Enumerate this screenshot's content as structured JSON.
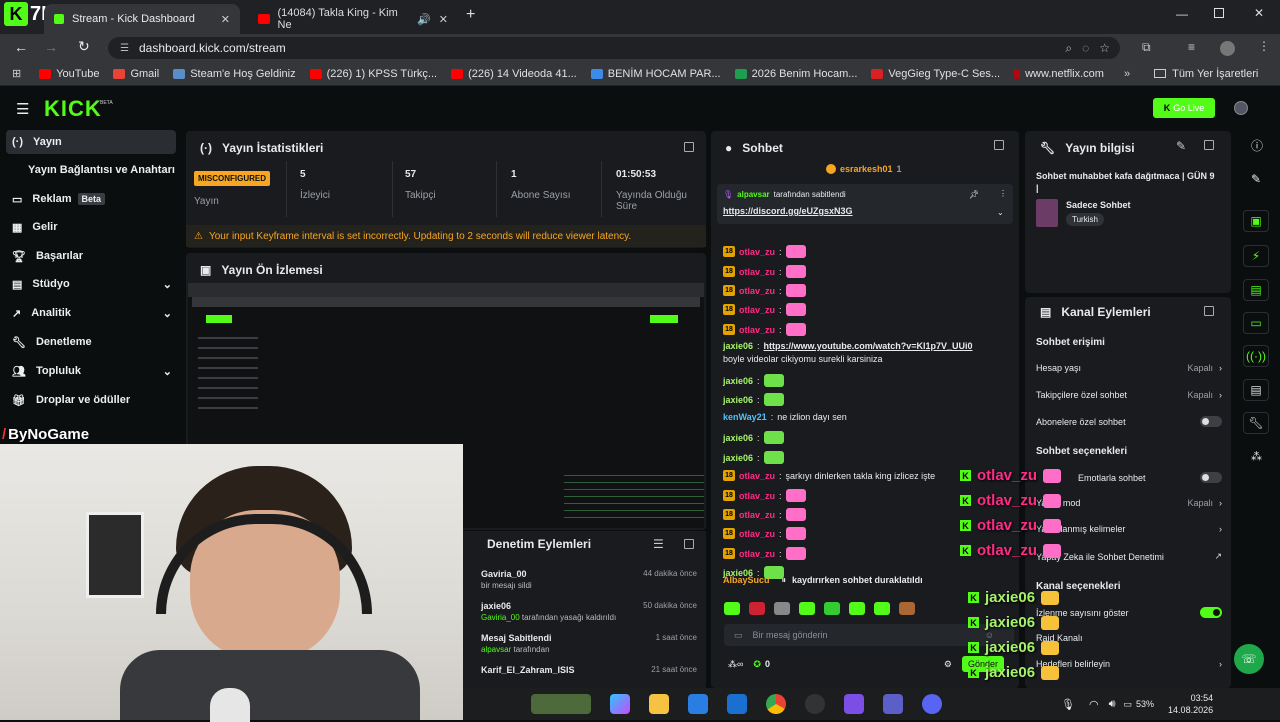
{
  "browser": {
    "tabs": [
      {
        "title": "Stream - Kick Dashboard",
        "active": true
      },
      {
        "title": "(14084) Takla King - Kim Ne",
        "active": false
      }
    ],
    "url": "dashboard.kick.com/stream",
    "bookmarks": [
      "YouTube",
      "Gmail",
      "Steam'e Hoş Geldiniz",
      "(226) 1) KPSS Türkç...",
      "(226) 14 Videoda 41...",
      "BENİM HOCAM PAR...",
      "2026 Benim Hocam...",
      "VegGieg Type-C Ses...",
      "www.netflix.com"
    ],
    "all_bookmarks": "Tüm Yer İşaretleri",
    "stream_overlay_tag": "7K"
  },
  "app": {
    "logo": "KICK",
    "logo_badge": "BETA",
    "go_live": "Go Live"
  },
  "sidebar": {
    "items": [
      {
        "label": "Yayın"
      },
      {
        "label": "Yayın Bağlantısı ve Anahtarı"
      },
      {
        "label": "Reklam",
        "badge": "Beta"
      },
      {
        "label": "Gelir"
      },
      {
        "label": "Başarılar"
      },
      {
        "label": "Stüdyo"
      },
      {
        "label": "Analitik"
      },
      {
        "label": "Denetleme"
      },
      {
        "label": "Topluluk"
      },
      {
        "label": "Droplar ve ödüller"
      }
    ],
    "channel_watermark": "ByNoGame"
  },
  "stats": {
    "title": "Yayın İstatistikleri",
    "status_badge": "MISCONFIGURED",
    "status_label": "Yayın",
    "items": [
      {
        "value": "5",
        "label": "İzleyici"
      },
      {
        "value": "57",
        "label": "Takipçi"
      },
      {
        "value": "1",
        "label": "Abone Sayısı"
      },
      {
        "value": "01:50:53",
        "label": "Yayında Olduğu Süre"
      }
    ],
    "warning": "Your input Keyframe interval is set incorrectly. Updating to 2 seconds will reduce viewer latency."
  },
  "preview": {
    "title": "Yayın Ön İzlemesi"
  },
  "moderation": {
    "title": "Denetim Eylemleri",
    "items": [
      {
        "user": "Gaviria_00",
        "detail": "bir mesajı sildi",
        "time": "44 dakika önce"
      },
      {
        "user": "jaxie06",
        "actor": "Gaviria_00",
        "detail": "tarafından yasağı kaldırıldı",
        "time": "50 dakika önce"
      },
      {
        "user": "Mesaj Sabitlendi",
        "actor": "alpavsar",
        "detail": "tarafından",
        "time": "1 saat önce"
      },
      {
        "user": "Karif_El_Zahram_ISIS",
        "time": "21 saat önce"
      }
    ]
  },
  "chat": {
    "title": "Sohbet",
    "top_user": "esrarkesh01",
    "top_count": "1",
    "pinned": {
      "by": "alpavsar",
      "text": "tarafından sabitlendi",
      "link": "https://discord.gg/eUZgsxN3G"
    },
    "messages": [
      {
        "badge": "18",
        "user": "otlav_zu",
        "text": "",
        "emote": true
      },
      {
        "badge": "18",
        "user": "otlav_zu",
        "text": "",
        "emote": true
      },
      {
        "badge": "18",
        "user": "otlav_zu",
        "text": "",
        "emote": true
      },
      {
        "badge": "18",
        "user": "otlav_zu",
        "text": "",
        "emote": true
      },
      {
        "badge": "18",
        "user": "otlav_zu",
        "text": "",
        "emote": true
      },
      {
        "badge": "",
        "user": "jaxie06",
        "text": "https://www.youtube.com/watch?v=Kl1p7V_UUi0"
      },
      {
        "badge": "",
        "user": "",
        "text": "boyle videolar cikiyomu surekli karsiniza"
      },
      {
        "badge": "",
        "user": "jaxie06",
        "text": "",
        "emote": true
      },
      {
        "badge": "",
        "user": "jaxie06",
        "text": "",
        "emote": true
      },
      {
        "badge": "",
        "user": "kenWay21",
        "text": "ne izlion dayı sen"
      },
      {
        "badge": "",
        "user": "jaxie06",
        "text": "",
        "emote": true
      },
      {
        "badge": "",
        "user": "jaxie06",
        "text": "",
        "emote": true
      },
      {
        "badge": "18",
        "user": "otlav_zu",
        "text": "şarkıyı dinlerken takla king izlicez işte"
      },
      {
        "badge": "18",
        "user": "otlav_zu",
        "text": "",
        "emote": true
      },
      {
        "badge": "18",
        "user": "otlav_zu",
        "text": "",
        "emote": true
      },
      {
        "badge": "18",
        "user": "otlav_zu",
        "text": "",
        "emote": true
      },
      {
        "badge": "18",
        "user": "otlav_zu",
        "text": "",
        "emote": true
      },
      {
        "badge": "",
        "user": "jaxie06",
        "text": "",
        "emote": true
      }
    ],
    "paused_user": "AlbaySucu",
    "paused": "kaydırırken sohbet duraklatıldı",
    "input_placeholder": "Bir mesaj gönderin",
    "points": "0",
    "send": "Gönder"
  },
  "info": {
    "title": "Yayın bilgisi",
    "stream_title": "Sohbet muhabbet kafa dağıtmaca | GÜN 9 |",
    "category": "Sadece Sohbet",
    "language": "Turkish"
  },
  "channel_actions": {
    "title": "Kanal Eylemleri",
    "chat_access": "Sohbet erişimi",
    "access_rows": [
      {
        "label": "Hesap yaşı",
        "value": "Kapalı"
      },
      {
        "label": "Takipçilere özel sohbet",
        "value": "Kapalı"
      },
      {
        "label": "Abonelere özel sohbet",
        "toggle": false
      }
    ],
    "chat_options": "Sohbet seçenekleri",
    "option_rows": [
      {
        "label": "Emotlarla sohbet",
        "toggle": false
      },
      {
        "label": "Yavaş mod",
        "value": "Kapalı"
      },
      {
        "label": "Yasaklanmış kelimeler"
      },
      {
        "label": "Yapay Zeka ile Sohbet Denetimi"
      }
    ],
    "channel_options": "Kanal seçenekleri",
    "channel_rows": [
      {
        "label": "İzlenme sayısını göster",
        "toggle": true
      },
      {
        "label": "Raid Kanalı"
      },
      {
        "label": "Hedefleri belirleyin"
      }
    ]
  },
  "overlay_chat": [
    {
      "user": "otlav_zu"
    },
    {
      "user": "otlav_zu"
    },
    {
      "user": "otlav_zu"
    },
    {
      "user": "otlav_zu"
    },
    {
      "user": "jaxie06"
    },
    {
      "user": "jaxie06"
    },
    {
      "user": "jaxie06"
    },
    {
      "user": "jaxie06"
    }
  ],
  "taskbar": {
    "time": "03:54",
    "date": "14.08.2026",
    "battery": "53%"
  },
  "colors": {
    "kick_green": "#53fc18",
    "warn": "#f6a623",
    "mod_user": "#ffd24d",
    "otlav": "#ff2b87",
    "pink_emote": "#ff6ec7"
  }
}
